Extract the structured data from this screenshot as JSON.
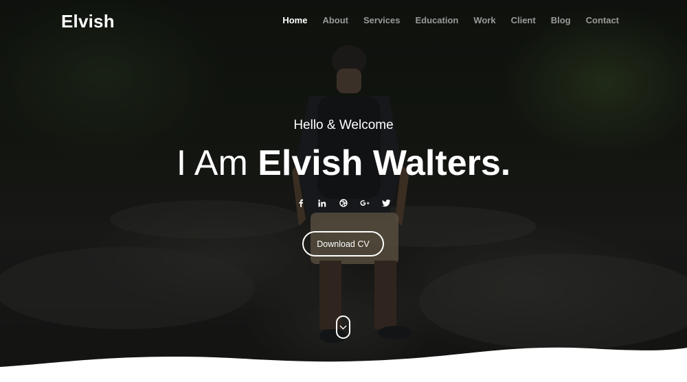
{
  "brand": "Elvish",
  "nav": [
    {
      "label": "Home",
      "active": true
    },
    {
      "label": "About"
    },
    {
      "label": "Services"
    },
    {
      "label": "Education"
    },
    {
      "label": "Work"
    },
    {
      "label": "Client"
    },
    {
      "label": "Blog"
    },
    {
      "label": "Contact"
    }
  ],
  "hero": {
    "greeting": "Hello & Welcome",
    "headline_light": "I Am ",
    "headline_bold": "Elvish Walters.",
    "cta_label": "Download CV"
  },
  "social": [
    {
      "icon": "facebook-icon",
      "glyph": "f"
    },
    {
      "icon": "linkedin-icon",
      "glyph": "in"
    },
    {
      "icon": "dribbble-icon",
      "glyph": "◎"
    },
    {
      "icon": "google-plus-icon",
      "glyph": "G+"
    },
    {
      "icon": "twitter-icon",
      "glyph": "🐦"
    }
  ]
}
